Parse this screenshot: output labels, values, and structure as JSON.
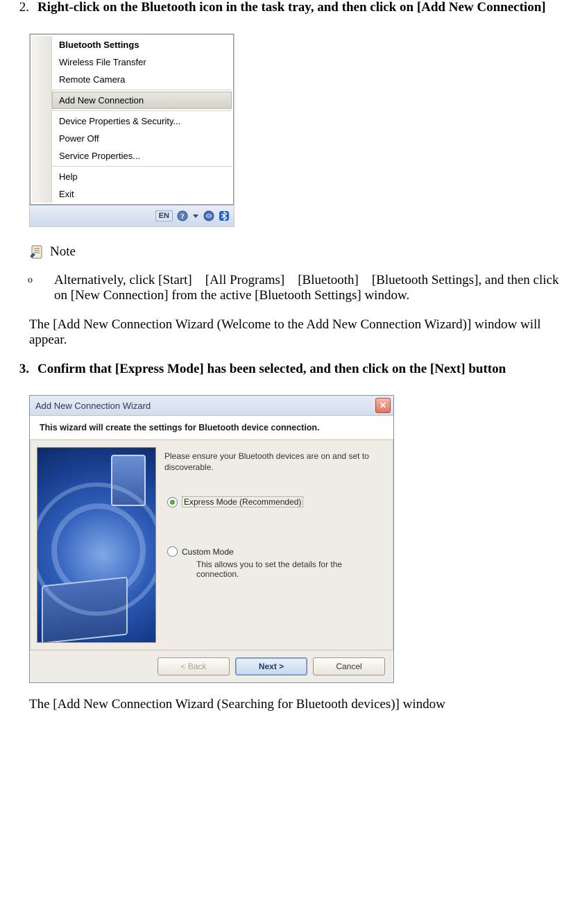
{
  "step2": {
    "number": "2.",
    "title": "Right-click on the Bluetooth icon in the task tray, and then click on [Add New Connection]"
  },
  "context_menu": {
    "items": [
      "Bluetooth Settings",
      "Wireless File Transfer",
      "Remote Camera",
      "Add New Connection",
      "Device Properties & Security...",
      "Power Off",
      "Service Properties...",
      "Help",
      "Exit"
    ]
  },
  "taskbar": {
    "lang": "EN"
  },
  "note": {
    "label": "Note",
    "alt": "Alternatively, click [Start] [All Programs] [Bluetooth] [Bluetooth Settings], and then click on [New Connection] from the active [Bluetooth Settings] window."
  },
  "after2": "The [Add New Connection Wizard (Welcome to the Add New Connection Wizard)] window will appear.",
  "step3": {
    "number": "3.",
    "title": "Confirm that [Express Mode] has been selected, and then click on the [Next] button"
  },
  "wizard": {
    "title": "Add New Connection Wizard",
    "banner": "This wizard will create the settings for Bluetooth device connection.",
    "instructions": "Please ensure your Bluetooth devices are on and set to discoverable.",
    "express_label": "Express Mode (Recommended)",
    "custom_label": "Custom Mode",
    "custom_sub": "This allows you to set the details for the connection.",
    "btn_back": "< Back",
    "btn_next": "Next >",
    "btn_cancel": "Cancel"
  },
  "after3": "The [Add New Connection Wizard (Searching for Bluetooth devices)] window"
}
